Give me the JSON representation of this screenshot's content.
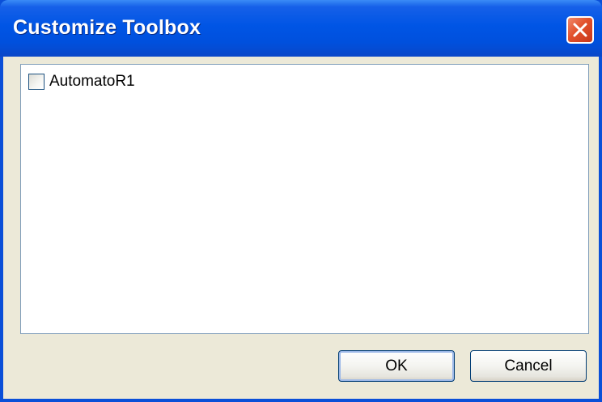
{
  "window": {
    "title": "Customize Toolbox"
  },
  "list": {
    "items": [
      {
        "label": "AutomatoR1",
        "checked": false
      }
    ]
  },
  "buttons": {
    "ok_label": "OK",
    "cancel_label": "Cancel"
  },
  "icons": {
    "close": "close-icon"
  },
  "colors": {
    "titlebar": "#0055e5",
    "close_button": "#e2512c",
    "dialog_face": "#ece9d8",
    "list_border": "#7f9db9",
    "button_border": "#003c74"
  }
}
